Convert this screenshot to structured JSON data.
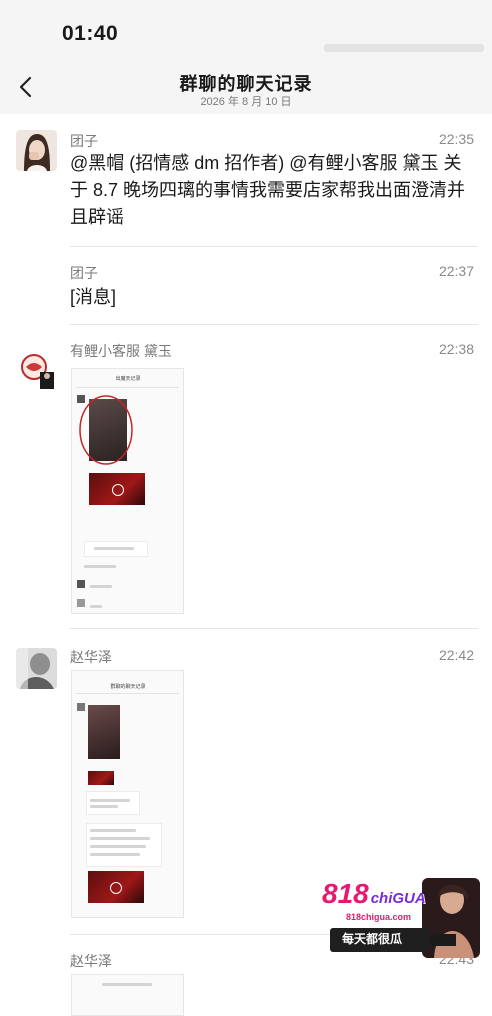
{
  "status_bar": {
    "time": "01:40"
  },
  "header": {
    "back_icon": "chevron-left-icon",
    "title": "群聊的聊天记录",
    "date": "2026 年 8 月 10 日"
  },
  "messages": [
    {
      "sender": "团子",
      "time": "22:35",
      "text_lines": [
        "@黑帽 (招情感 dm 招作者) @有鲤小客服 黛玉 关",
        "于 8.7 晚场四璃的事情我需要店家帮我出面澄清并",
        "且辟谣"
      ]
    },
    {
      "sender": "团子",
      "time": "22:37",
      "text": "[消息]"
    },
    {
      "sender": "有鲤小客服 黛玉",
      "time": "22:38",
      "attachment": "image",
      "image_title": "出魔天记录"
    },
    {
      "sender": "赵华泽",
      "time": "22:42",
      "attachment": "image",
      "image_title": "群聊的聊天记录"
    },
    {
      "sender": "赵华泽",
      "time": "22:43"
    }
  ],
  "watermark": {
    "brand": "818",
    "brand_suffix": "chiGUA",
    "url": "818chigua.com",
    "slogan": "每天都很瓜"
  },
  "colors": {
    "background": "#ffffff",
    "bar": "#f5f5f5",
    "meta": "#7a7a7a",
    "brand": "#e7186e"
  }
}
